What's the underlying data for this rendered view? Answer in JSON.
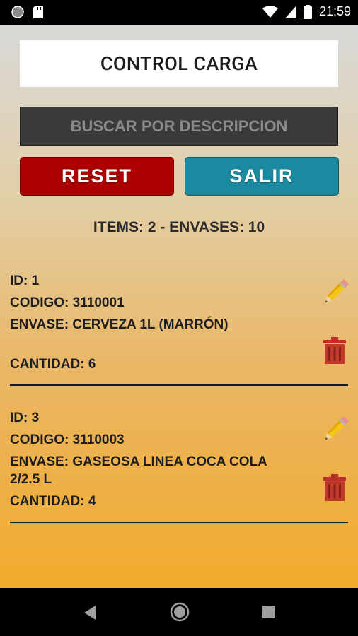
{
  "status_bar": {
    "time": "21:59",
    "icons": [
      "circle-icon",
      "sd-card-icon",
      "wifi-icon",
      "signal-icon",
      "battery-icon"
    ]
  },
  "header": {
    "title": "CONTROL CARGA"
  },
  "search": {
    "placeholder": "BUSCAR POR DESCRIPCION",
    "value": ""
  },
  "buttons": {
    "reset_label": "RESET",
    "salir_label": "SALIR"
  },
  "summary": {
    "text": "ITEMS: 2 - ENVASES: 10"
  },
  "items": [
    {
      "id": "ID: 1",
      "codigo": "CODIGO: 3110001",
      "envase": "ENVASE: CERVEZA 1L (MARRÓN)",
      "envase_line2": "",
      "cantidad": "CANTIDAD: 6"
    },
    {
      "id": "ID: 3",
      "codigo": "CODIGO: 3110003",
      "envase": "ENVASE: GASEOSA LINEA COCA COLA",
      "envase_line2": "2/2.5 L",
      "cantidad": "CANTIDAD: 4"
    }
  ],
  "colors": {
    "reset": "#ad0000",
    "salir": "#1b8aa0",
    "trash": "#c0392b",
    "background_top": "#d9d9d8",
    "background_bottom": "#f2aa2c"
  }
}
